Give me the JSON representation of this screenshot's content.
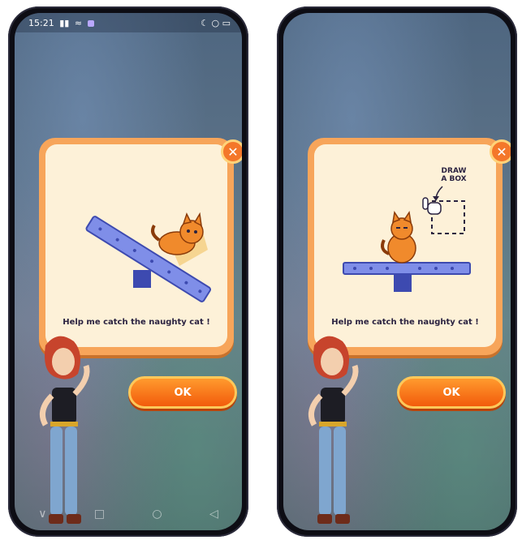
{
  "left_phone": {
    "status": {
      "time": "15:21",
      "right_glyphs": "☾ ○ ▭"
    },
    "dialog": {
      "caption": "Help me catch the naughty cat !",
      "ok_label": "OK",
      "close_glyph": "✕"
    },
    "nav": {
      "back_glyph": "◁",
      "home_glyph": "○",
      "menu_glyph": "□",
      "down_glyph": "∨"
    }
  },
  "right_phone": {
    "dialog": {
      "caption": "Help me catch the naughty cat !",
      "hint_line1": "DRAW",
      "hint_line2": "A BOX",
      "ok_label": "OK",
      "close_glyph": "✕"
    }
  },
  "colors": {
    "card_border": "#f7a55a",
    "card_fill": "#fdf1d8",
    "ok_button": "#f25b0c",
    "plank": "#7f8ee8",
    "cat": "#f08a2c"
  },
  "icons": [
    "close-icon",
    "cat-icon",
    "hand-pointer-icon",
    "arrow-icon",
    "signal-icon",
    "wifi-icon",
    "battery-icon"
  ]
}
